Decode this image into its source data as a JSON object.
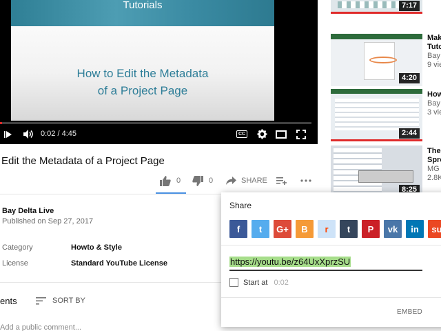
{
  "player": {
    "slide_banner": "Tutorials",
    "slide_title_line1": "How to Edit the Metadata",
    "slide_title_line2": "of a Project Page",
    "time": "0:02 / 4:45",
    "played_fraction": 0.007,
    "icons": [
      "play-icon",
      "volume-icon",
      "captions-icon",
      "settings-icon",
      "theater-icon",
      "fullscreen-icon"
    ],
    "cc_label": "CC"
  },
  "video": {
    "title": "Edit the Metadata of a Project Page",
    "likes": "0",
    "dislikes": "0",
    "share_label": "SHARE",
    "channel": "Bay Delta Live",
    "published": "Published on Sep 27, 2017",
    "category_label": "Category",
    "category_value": "Howto & Style",
    "license_label": "License",
    "license_value": "Standard YouTube License"
  },
  "comments": {
    "label": "ents",
    "sort_by": "SORT BY",
    "placeholder": "Add a public comment..."
  },
  "related": [
    {
      "duration": "7:17",
      "title": "",
      "meta": ""
    },
    {
      "duration": "4:20",
      "title": "Mak",
      "title2": "Tuto",
      "channel": "Bay",
      "meta": "9 vie"
    },
    {
      "duration": "2:44",
      "title": "How",
      "channel": "Bay",
      "meta": "3 vie"
    },
    {
      "duration": "8:25",
      "title": "The",
      "title2": "Spre",
      "channel": "MG I",
      "meta": "2.8K"
    }
  ],
  "share": {
    "title": "Share",
    "url": "https://youtu.be/z64UxXprzSU",
    "start_at_label": "Start at",
    "start_at_time": "0:02",
    "embed_label": "EMBED",
    "networks": [
      {
        "name": "facebook-icon",
        "glyph": "f",
        "color": "#3b5998"
      },
      {
        "name": "twitter-icon",
        "glyph": "t",
        "color": "#55acee"
      },
      {
        "name": "google-plus-icon",
        "glyph": "G+",
        "color": "#dd4b39"
      },
      {
        "name": "blogger-icon",
        "glyph": "B",
        "color": "#f59a37"
      },
      {
        "name": "reddit-icon",
        "glyph": "r",
        "color": "#cee3f8"
      },
      {
        "name": "tumblr-icon",
        "glyph": "t",
        "color": "#35465c"
      },
      {
        "name": "pinterest-icon",
        "glyph": "P",
        "color": "#cb2027"
      },
      {
        "name": "vk-icon",
        "glyph": "vk",
        "color": "#4a76a8"
      },
      {
        "name": "linkedin-icon",
        "glyph": "in",
        "color": "#0077b5"
      },
      {
        "name": "stumbleupon-icon",
        "glyph": "su",
        "color": "#eb4823"
      }
    ]
  }
}
